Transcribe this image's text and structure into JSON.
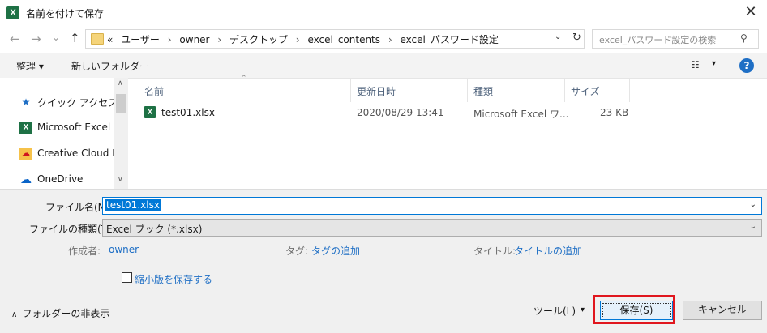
{
  "window": {
    "app_icon_letter": "X",
    "title": "名前を付けて保存",
    "close_glyph": "✕"
  },
  "address_bar": {
    "back_glyph": "←",
    "forward_glyph": "→",
    "recent_glyph": "⌄",
    "up_glyph": "↑",
    "crumb_prefix": "«",
    "crumbs": [
      "ユーザー",
      "owner",
      "デスクトップ",
      "excel_contents",
      "excel_パスワード設定"
    ],
    "crumb_separator": "›",
    "dropdown_glyph": "⌄",
    "refresh_glyph": "↻",
    "search_placeholder": "excel_パスワード設定の検索",
    "search_glyph": "⚲"
  },
  "toolbar": {
    "organize_label": "整理 ▾",
    "new_folder_label": "新しいフォルダー",
    "view_glyph": "☷",
    "view_dd_glyph": "▾",
    "help_glyph": "?"
  },
  "nav_pane": {
    "items": [
      {
        "label": "クイック アクセス",
        "icon": "star-icon"
      },
      {
        "label": "Microsoft Excel",
        "icon": "excel-icon"
      },
      {
        "label": "Creative Cloud File",
        "icon": "creative-cloud-icon"
      },
      {
        "label": "OneDrive",
        "icon": "onedrive-icon"
      }
    ],
    "scroll_up": "∧",
    "scroll_down": "∨"
  },
  "file_list": {
    "columns": [
      "名前",
      "更新日時",
      "種類",
      "サイズ"
    ],
    "sort_glyph": "⌃",
    "rows": [
      {
        "name": "test01.xlsx",
        "modified": "2020/08/29 13:41",
        "type": "Microsoft Excel ワ...",
        "size": "23 KB"
      }
    ]
  },
  "form": {
    "filename_label": "ファイル名(N):",
    "filename_value": "test01.xlsx",
    "filetype_label": "ファイルの種類(T):",
    "filetype_value": "Excel ブック (*.xlsx)",
    "dd_glyph": "⌄",
    "author_label": "作成者:",
    "author_value": "owner",
    "tags_label": "タグ:",
    "tags_value": "タグの追加",
    "title_label": "タイトル:",
    "title_value": "タイトルの追加",
    "thumbnail_label": "縮小版を保存する"
  },
  "footer": {
    "hide_folders_label": "フォルダーの非表示",
    "hide_glyph": "∧",
    "tools_label": "ツール(L)",
    "tools_dd": "▾",
    "save_label": "保存(S)",
    "cancel_label": "キャンセル"
  },
  "colors": {
    "accent": "#0078d7",
    "highlight_box": "#e0161e",
    "link": "#1f6fc5",
    "excel_green": "#1e7145"
  }
}
